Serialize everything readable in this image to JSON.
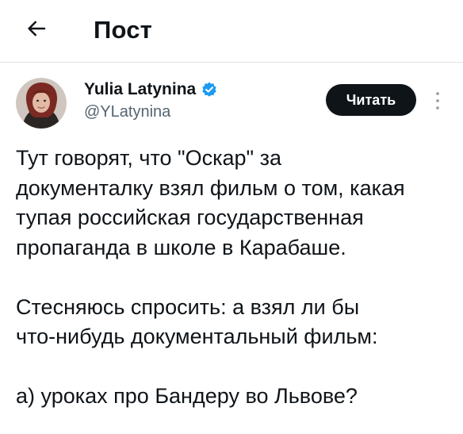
{
  "header": {
    "back_icon": "arrow-left-icon",
    "title": "Пост"
  },
  "author": {
    "name": "Yulia Latynina",
    "handle": "@YLatynina",
    "verified_icon": "verified-badge-icon",
    "verified_color": "#1d9bf0"
  },
  "actions": {
    "read_label": "Читать",
    "more_icon": "more-vertical-icon"
  },
  "tweet": {
    "lines": [
      "Тут говорят, что \"Оскар\" за",
      "документалку взял фильм о  том, какая",
      "тупая российская государственная",
      "пропаганда в школе в Карабаше.",
      "",
      "Стесняюсь спросить: а взял ли бы",
      "что-нибудь документальный фильм:",
      "",
      "а) уроках про Бандеру во Львове?"
    ]
  },
  "colors": {
    "text": "#0f1419",
    "secondary_text": "#536471",
    "button_bg": "#0f1419",
    "button_text": "#ffffff",
    "divider": "#dfe3e6"
  }
}
